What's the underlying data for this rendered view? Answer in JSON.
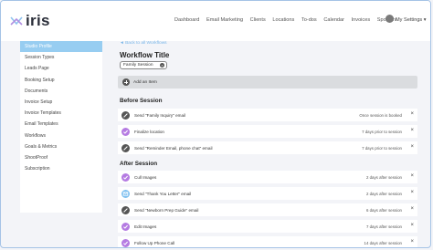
{
  "app": {
    "logo_text": "iris"
  },
  "nav": {
    "items": [
      "Dashboard",
      "Email Marketing",
      "Clients",
      "Locations",
      "To-dos",
      "Calendar",
      "Invoices",
      "Spotlight"
    ],
    "settings_label": "My Settings"
  },
  "sidebar": {
    "items": [
      "Studio Profile",
      "Session Types",
      "Leads Page",
      "Booking Setup",
      "Documents",
      "Invoice Setup",
      "Invoice Templates",
      "Email Templates",
      "Workflows",
      "Goals & Metrics",
      "ShootProof",
      "Subscription"
    ],
    "active_index": 0
  },
  "main": {
    "back_link": "◄ Back to all Workflows",
    "workflow_title_label": "Workflow Title",
    "workflow_title_value": "Family Session",
    "add_item_label": "Add an Item",
    "before_session_title": "Before Session",
    "after_session_title": "After Session",
    "before_rows": [
      {
        "label": "Send \"Family Inquiry\" email",
        "timing": "Once session is booked",
        "icon": "envelope-icon",
        "color": "#555555"
      },
      {
        "label": "Finalize location",
        "timing": "7 days prior to session",
        "icon": "check-icon",
        "color": "#b57be2"
      },
      {
        "label": "Send \"Reminder Email, phone chat\" email",
        "timing": "7 days prior to session",
        "icon": "envelope-icon",
        "color": "#555555"
      }
    ],
    "after_rows": [
      {
        "label": "Cull Images",
        "timing": "2 days after session",
        "icon": "check-icon",
        "color": "#b57be2"
      },
      {
        "label": "Send \"Thank You Letter\" email",
        "timing": "2 days after session",
        "icon": "envelope-icon",
        "color": "#7fc0f0"
      },
      {
        "label": "Send \"Newborn Prep Guide\" email",
        "timing": "6 days after session",
        "icon": "envelope-icon",
        "color": "#555555"
      },
      {
        "label": "Edit Images",
        "timing": "7 days after session",
        "icon": "check-icon",
        "color": "#b57be2"
      },
      {
        "label": "Follow Up Phone Call",
        "timing": "14 days after session",
        "icon": "check-icon",
        "color": "#b57be2"
      }
    ],
    "delete_glyph": "×"
  }
}
